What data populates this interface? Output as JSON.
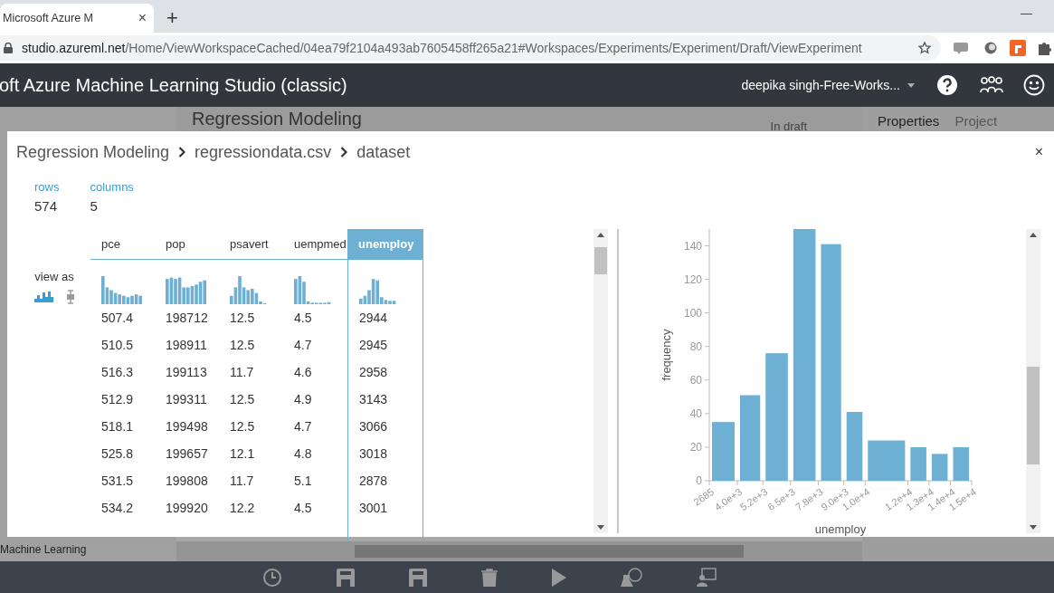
{
  "browser": {
    "tab_title": "Microsoft Azure M",
    "tab_close": "×",
    "new_tab": "+",
    "minimize": "—",
    "url_host": "studio.azureml.net",
    "url_path": "/Home/ViewWorkspaceCached/04ea79f2104a493ab7605458ff265a21#Workspaces/Experiments/Experiment/Draft/ViewExperiment"
  },
  "app_header": {
    "title": "oft Azure Machine Learning Studio (classic)",
    "user": "deepika singh-Free-Works..."
  },
  "background_page": {
    "experiment_title": "Regression Modeling",
    "status": "In draft",
    "panel_tabs": [
      {
        "label": "Properties",
        "selected": true
      },
      {
        "label": "Project",
        "selected": false
      }
    ],
    "sidebar_footer": "Machine Learning"
  },
  "dialog": {
    "breadcrumb": [
      "Regression Modeling",
      "regressiondata.csv",
      "dataset"
    ],
    "close": "×",
    "stats": [
      {
        "label": "rows",
        "value": "574"
      },
      {
        "label": "columns",
        "value": "5"
      }
    ],
    "view_as": {
      "label": "view as",
      "options": [
        {
          "kind": "histogram",
          "selected": true
        },
        {
          "kind": "boxplot",
          "selected": false
        }
      ]
    },
    "columns": [
      {
        "label": "pce",
        "selected": false
      },
      {
        "label": "pop",
        "selected": false
      },
      {
        "label": "psavert",
        "selected": false
      },
      {
        "label": "uempmed",
        "selected": false
      },
      {
        "label": "unemploy",
        "selected": true
      }
    ],
    "rows": [
      [
        "507.4",
        "198712",
        "12.5",
        "4.5",
        "2944"
      ],
      [
        "510.5",
        "198911",
        "12.5",
        "4.7",
        "2945"
      ],
      [
        "516.3",
        "199113",
        "11.7",
        "4.6",
        "2958"
      ],
      [
        "512.9",
        "199311",
        "12.5",
        "4.9",
        "3143"
      ],
      [
        "518.1",
        "199498",
        "12.5",
        "4.7",
        "3066"
      ],
      [
        "525.8",
        "199657",
        "12.1",
        "4.8",
        "3018"
      ],
      [
        "531.5",
        "199808",
        "11.7",
        "5.1",
        "2878"
      ],
      [
        "534.2",
        "199920",
        "12.2",
        "4.5",
        "3001"
      ]
    ],
    "chart_data": {
      "type": "bar",
      "xlabel": "unemploy",
      "ylabel": "frequency",
      "x": [
        3342.5,
        4600,
        5850,
        7150,
        8400,
        9500,
        11000,
        12500,
        13500,
        14500
      ],
      "values": [
        35,
        51,
        76,
        150,
        141,
        41,
        24,
        20,
        16,
        20
      ],
      "xlim": [
        2685,
        15000
      ],
      "ylim": [
        0,
        150
      ],
      "xticks": [
        {
          "value": 2685,
          "label": "2685"
        },
        {
          "value": 4000,
          "label": "4.0e+3"
        },
        {
          "value": 5200,
          "label": "5.2e+3"
        },
        {
          "value": 6500,
          "label": "6.5e+3"
        },
        {
          "value": 7800,
          "label": "7.8e+3"
        },
        {
          "value": 9000,
          "label": "9.0e+3"
        },
        {
          "value": 10000,
          "label": "1.0e+4"
        },
        {
          "value": 12000,
          "label": "1.2e+4"
        },
        {
          "value": 13000,
          "label": "1.3e+4"
        },
        {
          "value": 14000,
          "label": "1.4e+4"
        },
        {
          "value": 15000,
          "label": "1.5e+4"
        }
      ],
      "yticks": [
        0,
        20,
        40,
        60,
        80,
        100,
        120,
        140
      ]
    }
  }
}
